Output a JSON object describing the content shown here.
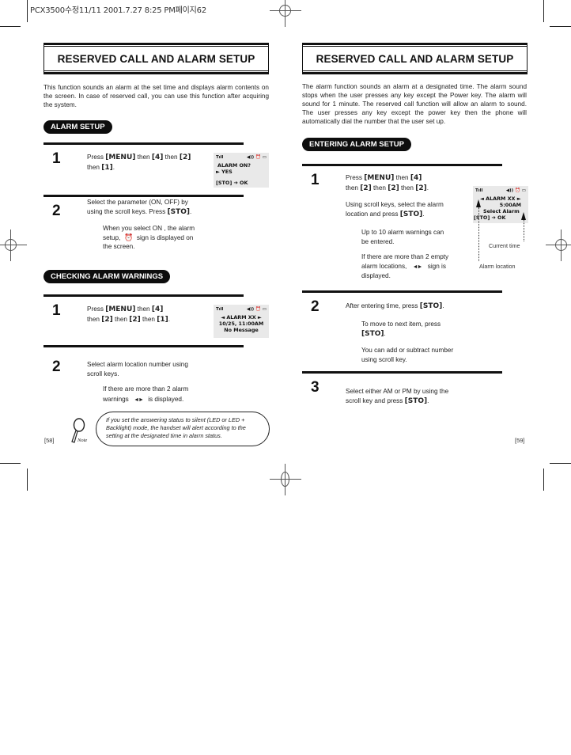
{
  "print_slug": "PCX3500수정11/11  2001.7.27 8:25 PM페이지62",
  "left_page": {
    "header_title": "RESERVED CALL AND ALARM SETUP",
    "intro": "This function sounds an alarm at the set time and displays alarm contents on the screen.  In case of reserved call, you can use this function after acquiring the system.",
    "sections": [
      {
        "label": "ALARM SETUP",
        "steps": [
          {
            "number": "1",
            "text_parts": [
              "Press ",
              "[MENU]",
              " then ",
              "[4]",
              " then ",
              "[2]",
              " then ",
              "[1]",
              "."
            ],
            "lcd": {
              "line1": "ALARM ON?",
              "line2": "► YES",
              "line3": "[STO] ➔ OK"
            }
          },
          {
            "number": "2",
            "text_line1": "Select the parameter (ON, OFF) by",
            "text_line2_pre": "using the scroll keys.  Press ",
            "text_line2_key": "[STO]",
            "text_line2_post": ".",
            "sub_line1": "When you select  ON , the alarm",
            "sub_line2_pre": "setup,",
            "sub_line2_post": "sign is displayed on",
            "sub_line3": "the screen."
          }
        ]
      },
      {
        "label": "CHECKING ALARM WARNINGS",
        "steps": [
          {
            "number": "1",
            "line1_pre": "Press ",
            "line1_key1": "[MENU]",
            "line1_mid": " then ",
            "line1_key2": "[4]",
            "line2_pre": "then ",
            "line2_key1": "[2]",
            "line2_mid1": "  then ",
            "line2_key2": "[2]",
            "line2_mid2": " then ",
            "line2_key3": "[1]",
            "line2_post": ".",
            "lcd": {
              "line1": "◄ ALARM XX ►",
              "line2": "10/25, 11:00AM",
              "line3": "No Message"
            }
          },
          {
            "number": "2",
            "text_line1": "Select alarm location number using",
            "text_line2": "scroll keys.",
            "sub_line1": "If there are more than 2 alarm",
            "sub_line2_pre": "warnings",
            "sub_line2_post": "is displayed."
          }
        ]
      }
    ],
    "note_label": "Note",
    "note_text": "If you set the answering status to silent (LED or LED + Backlight) mode, the handset will alert according to the setting at the designated time in alarm status.",
    "page_number": "[58]"
  },
  "right_page": {
    "header_title": "RESERVED CALL AND ALARM SETUP",
    "intro": "The alarm function sounds an alarm at a designated time.  The alarm sound stops when the user presses any key except the Power key.  The alarm will sound for 1 minute.  The reserved call function will allow an alarm to sound.  The user presses any key except the power key then the phone will automatically dial the number that the user set up.",
    "section_label": "ENTERING ALARM SETUP",
    "steps": [
      {
        "number": "1",
        "line1_pre": "Press ",
        "line1_key1": "[MENU]",
        "line1_mid": " then ",
        "line1_key2": "[4]",
        "line2_pre": "then ",
        "line2_key1": "[2]",
        "line2_mid1": " then ",
        "line2_key2": "[2]",
        "line2_mid2": " then ",
        "line2_key3": "[2]",
        "line2_post": ".",
        "para2_line1": "Using scroll keys, select the alarm",
        "para2_line2_pre": "location and press ",
        "para2_line2_key": "[STO]",
        "para2_line2_post": ".",
        "sub1_line1": "Up to 10 alarm warnings can",
        "sub1_line2": "be entered.",
        "sub2_line1": "If there are more than 2 empty",
        "sub2_line2_pre": "alarm locations,",
        "sub2_line2_post": "sign is",
        "sub2_line3": "displayed.",
        "lcd": {
          "line1": "◄ ALARM XX ►",
          "line2": "5:00AM",
          "line3": "Select Alarm",
          "line4": "[STO] ➔ OK"
        },
        "callout_current_time": "Current time",
        "callout_alarm_location": "Alarm location"
      },
      {
        "number": "2",
        "line1_pre": "After entering time, press ",
        "line1_key": "[STO]",
        "line1_post": ".",
        "sub1_line1": "To move to next item, press",
        "sub1_line2_key": "[STO]",
        "sub1_line2_post": ".",
        "sub2_line1": "You can add or subtract number",
        "sub2_line2": "using scroll key."
      },
      {
        "number": "3",
        "line1": "Select either AM or PM by using the",
        "line2_pre": "scroll key and press ",
        "line2_key": "[STO]",
        "line2_post": "."
      }
    ],
    "page_number": "[59]"
  },
  "icons": {
    "signal": "Tıll",
    "status": "◀)) ⏰ ▭",
    "scroll_arrows": "◄►"
  }
}
